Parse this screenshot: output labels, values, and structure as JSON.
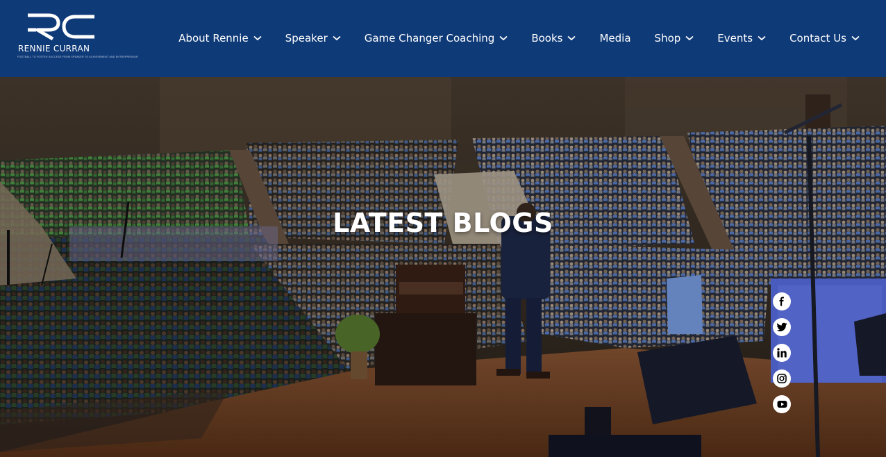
{
  "brand": {
    "name": "RENNIE CURRAN",
    "tagline": "FOOTBALL TO FOSTER SUCCESS FROM SPEAKER TO ACHIEVEMENT AND ENTREPRENEUR"
  },
  "nav": {
    "items": [
      {
        "label": "About Rennie",
        "dropdown": true
      },
      {
        "label": "Speaker",
        "dropdown": true
      },
      {
        "label": "Game Changer Coaching",
        "dropdown": true
      },
      {
        "label": "Books",
        "dropdown": true
      },
      {
        "label": "Media",
        "dropdown": false
      },
      {
        "label": "Shop",
        "dropdown": true
      },
      {
        "label": "Events",
        "dropdown": true
      },
      {
        "label": "Contact Us",
        "dropdown": true
      }
    ]
  },
  "hero": {
    "title": "LATEST BLOGS"
  },
  "social": [
    {
      "name": "facebook-icon"
    },
    {
      "name": "twitter-icon"
    },
    {
      "name": "linkedin-icon"
    },
    {
      "name": "instagram-icon"
    },
    {
      "name": "youtube-icon"
    }
  ],
  "colors": {
    "header_bg": "#0f3a78",
    "text": "#ffffff",
    "stage_wood": "#7a4a2c",
    "audience_green": "#3f7d3c",
    "audience_blue": "#4a6fb8"
  }
}
